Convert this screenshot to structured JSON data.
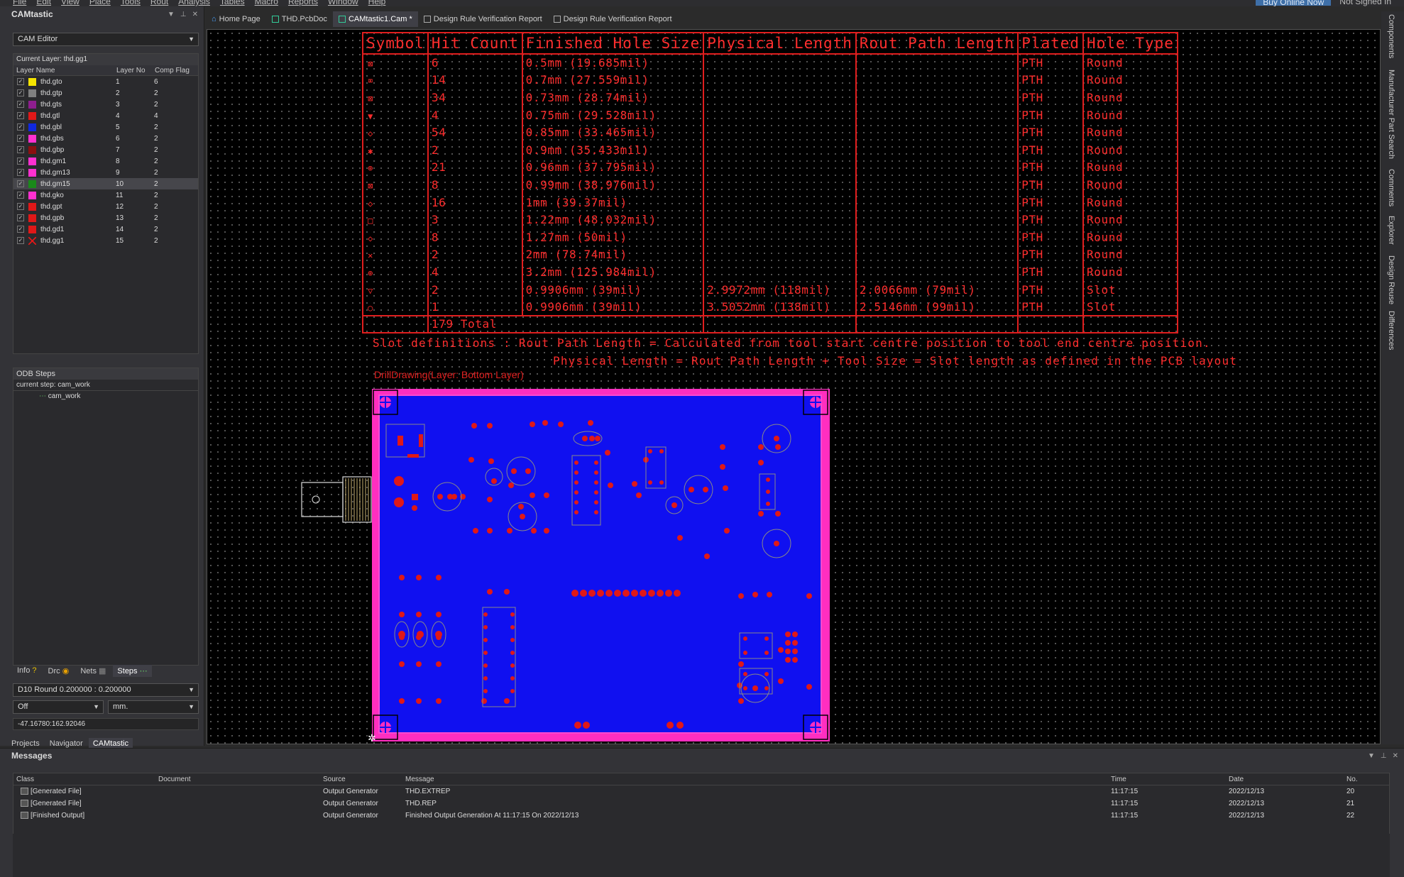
{
  "menu": {
    "items": [
      "File",
      "Edit",
      "View",
      "Place",
      "Tools",
      "Rout",
      "Analysis",
      "Tables",
      "Macro",
      "Reports",
      "Window",
      "Help"
    ],
    "buy_label": "Buy Online Now",
    "signin_label": "Not Signed In"
  },
  "left_panel": {
    "title": "CAMtastic",
    "editor_mode": "CAM Editor",
    "current_layer": "Current Layer: thd.gg1",
    "headers": {
      "name": "Layer Name",
      "no": "Layer No",
      "flag": "Comp Flag"
    },
    "layers": [
      {
        "name": "thd.gto",
        "no": "1",
        "flag": "6",
        "color": "#f5e400"
      },
      {
        "name": "thd.gtp",
        "no": "2",
        "flag": "2",
        "color": "#808080"
      },
      {
        "name": "thd.gts",
        "no": "3",
        "flag": "2",
        "color": "#8e1e8e"
      },
      {
        "name": "thd.gtl",
        "no": "4",
        "flag": "4",
        "color": "#e01818"
      },
      {
        "name": "thd.gbl",
        "no": "5",
        "flag": "2",
        "color": "#1028e0"
      },
      {
        "name": "thd.gbs",
        "no": "6",
        "flag": "2",
        "color": "#ff30d0"
      },
      {
        "name": "thd.gbp",
        "no": "7",
        "flag": "2",
        "color": "#8a1010"
      },
      {
        "name": "thd.gm1",
        "no": "8",
        "flag": "2",
        "color": "#ff30d0"
      },
      {
        "name": "thd.gm13",
        "no": "9",
        "flag": "2",
        "color": "#ff30d0"
      },
      {
        "name": "thd.gm15",
        "no": "10",
        "flag": "2",
        "color": "#1a8a1a"
      },
      {
        "name": "thd.gko",
        "no": "11",
        "flag": "2",
        "color": "#ff30d0"
      },
      {
        "name": "thd.gpt",
        "no": "12",
        "flag": "2",
        "color": "#e01818"
      },
      {
        "name": "thd.gpb",
        "no": "13",
        "flag": "2",
        "color": "#e01818"
      },
      {
        "name": "thd.gd1",
        "no": "14",
        "flag": "2",
        "color": "#e01818"
      },
      {
        "name": "thd.gg1",
        "no": "15",
        "flag": "2",
        "color": "#e01818"
      }
    ],
    "odb_title": "ODB Steps",
    "odb_current": "current step: cam_work",
    "odb_step": "cam_work",
    "tabs": [
      "Info",
      "Drc",
      "Nets",
      "Steps"
    ],
    "aperture": "D10    Round    0.200000 : 0.200000",
    "snap": "Off",
    "units": "mm.",
    "coords": "-47.16780:162.92046",
    "bottom_tabs": [
      "Projects",
      "Navigator",
      "CAMtastic"
    ]
  },
  "doc_tabs": [
    "Home Page",
    "THD.PcbDoc",
    "CAMtastic1.Cam *",
    "Design Rule Verification Report",
    "Design Rule Verification Report"
  ],
  "drill_table": {
    "headers": [
      "Symbol",
      "Hit Count",
      "Finished Hole Size",
      "Physical Length",
      "Rout Path Length",
      "Plated",
      "Hole Type"
    ],
    "rows": [
      {
        "sym": "⊠",
        "hits": "6",
        "size": "0.5mm (19.685mil)",
        "phys": "",
        "rout": "",
        "plated": "PTH",
        "type": "Round"
      },
      {
        "sym": "⌧",
        "hits": "14",
        "size": "0.7mm (27.559mil)",
        "phys": "",
        "rout": "",
        "plated": "PTH",
        "type": "Round"
      },
      {
        "sym": "⊠",
        "hits": "34",
        "size": "0.73mm (28.74mil)",
        "phys": "",
        "rout": "",
        "plated": "PTH",
        "type": "Round"
      },
      {
        "sym": "▼",
        "hits": "4",
        "size": "0.75mm (29.528mil)",
        "phys": "",
        "rout": "",
        "plated": "PTH",
        "type": "Round"
      },
      {
        "sym": "◇",
        "hits": "54",
        "size": "0.85mm (33.465mil)",
        "phys": "",
        "rout": "",
        "plated": "PTH",
        "type": "Round"
      },
      {
        "sym": "✱",
        "hits": "2",
        "size": "0.9mm (35.433mil)",
        "phys": "",
        "rout": "",
        "plated": "PTH",
        "type": "Round"
      },
      {
        "sym": "⊕",
        "hits": "21",
        "size": "0.96mm (37.795mil)",
        "phys": "",
        "rout": "",
        "plated": "PTH",
        "type": "Round"
      },
      {
        "sym": "⊠",
        "hits": "8",
        "size": "0.99mm (38.976mil)",
        "phys": "",
        "rout": "",
        "plated": "PTH",
        "type": "Round"
      },
      {
        "sym": "◇",
        "hits": "16",
        "size": "1mm (39.37mil)",
        "phys": "",
        "rout": "",
        "plated": "PTH",
        "type": "Round"
      },
      {
        "sym": "□",
        "hits": "3",
        "size": "1.22mm (48.032mil)",
        "phys": "",
        "rout": "",
        "plated": "PTH",
        "type": "Round"
      },
      {
        "sym": "◇",
        "hits": "8",
        "size": "1.27mm (50mil)",
        "phys": "",
        "rout": "",
        "plated": "PTH",
        "type": "Round"
      },
      {
        "sym": "✕",
        "hits": "2",
        "size": "2mm (78.74mil)",
        "phys": "",
        "rout": "",
        "plated": "PTH",
        "type": "Round"
      },
      {
        "sym": "⊕",
        "hits": "4",
        "size": "3.2mm (125.984mil)",
        "phys": "",
        "rout": "",
        "plated": "PTH",
        "type": "Round"
      },
      {
        "sym": "▽",
        "hits": "2",
        "size": "0.9906mm (39mil)",
        "phys": "2.9972mm (118mil)",
        "rout": "2.0066mm (79mil)",
        "plated": "PTH",
        "type": "Slot"
      },
      {
        "sym": "○",
        "hits": "1",
        "size": "0.9906mm (39mil)",
        "phys": "3.5052mm (138mil)",
        "rout": "2.5146mm (99mil)",
        "plated": "PTH",
        "type": "Slot"
      }
    ],
    "total": "179 Total"
  },
  "slot_note_1": "Slot definitions : Rout Path Length = Calculated from tool start centre position to tool end centre position.",
  "slot_note_2": "Physical Length  = Rout Path Length + Tool Size = Slot length as defined in the PCB layout",
  "overlay_text": "DrillDrawing(Layer: Bottom Layer)",
  "right_tabs": [
    "Components",
    "Manufacturer Part Search",
    "Comments",
    "Explorer",
    "Design Reuse",
    "Differences"
  ],
  "messages": {
    "title": "Messages",
    "headers": {
      "class": "Class",
      "document": "Document",
      "source": "Source",
      "message": "Message",
      "time": "Time",
      "date": "Date",
      "no": "No."
    },
    "rows": [
      {
        "class": "[Generated File]",
        "document": "",
        "source": "Output Generator",
        "message": "THD.EXTREP",
        "time": "11:17:15",
        "date": "2022/12/13",
        "no": "20"
      },
      {
        "class": "[Generated File]",
        "document": "",
        "source": "Output Generator",
        "message": "THD.REP",
        "time": "11:17:15",
        "date": "2022/12/13",
        "no": "21"
      },
      {
        "class": "[Finished Output]",
        "document": "",
        "source": "Output Generator",
        "message": "Finished Output Generation At 11:17:15 On 2022/12/13",
        "time": "11:17:15",
        "date": "2022/12/13",
        "no": "22"
      }
    ]
  }
}
